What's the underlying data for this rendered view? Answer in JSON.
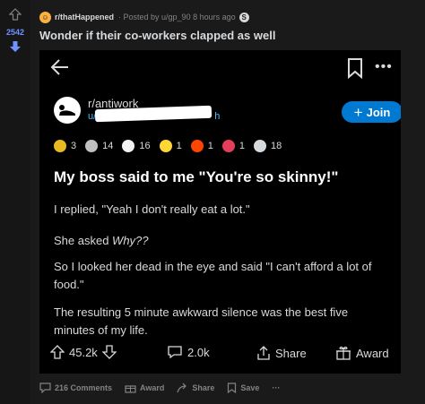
{
  "post": {
    "upvotes": "2542",
    "subreddit": "r/thatHappened",
    "posted_by": "· Posted by u/gp_90 8 hours ago",
    "title": "Wonder if their co-workers clapped as well"
  },
  "screenshot": {
    "subreddit": "r/antiwork",
    "user": "u/",
    "user_suffix": "h",
    "join_label": "Join",
    "awards": [
      "3",
      "14",
      "16",
      "1",
      "1",
      "1",
      "18"
    ],
    "headline": "My boss said to me \"You're so skinny!\"",
    "paragraphs": [
      "I replied, \"Yeah I don't really eat a lot.\"",
      "She asked Why??",
      "So I looked her dead in the eye and said \"I can't afford a lot of food.\"",
      "The resulting 5 minute awkward silence was the best five minutes of my life."
    ],
    "votes": "45.2k",
    "comments": "2.0k",
    "share_label": "Share",
    "award_label": "Award"
  },
  "bottom_bar": {
    "comments": "216 Comments",
    "award": "Award",
    "share": "Share",
    "save": "Save",
    "more": "···"
  },
  "colors": {
    "background": "#1a1a1b",
    "upvote_count": "#7193ff",
    "join_button": "#0079d3",
    "text": "#d7dadc",
    "muted": "#818384"
  }
}
